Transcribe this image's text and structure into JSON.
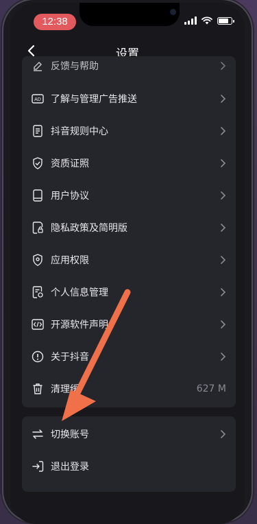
{
  "status_bar": {
    "time": "12:38"
  },
  "nav": {
    "title": "设置"
  },
  "settings_items": [
    {
      "label": "反馈与帮助",
      "icon": "edit-icon"
    },
    {
      "label": "了解与管理广告推送",
      "icon": "ad-icon"
    },
    {
      "label": "抖音规则中心",
      "icon": "rules-icon"
    },
    {
      "label": "资质证照",
      "icon": "shield-check-icon"
    },
    {
      "label": "用户协议",
      "icon": "book-icon"
    },
    {
      "label": "隐私政策及简明版",
      "icon": "privacy-doc-icon"
    },
    {
      "label": "应用权限",
      "icon": "location-shield-icon"
    },
    {
      "label": "个人信息管理",
      "icon": "personal-info-icon"
    },
    {
      "label": "开源软件声明",
      "icon": "code-icon"
    },
    {
      "label": "关于抖音",
      "icon": "info-icon"
    },
    {
      "label": "清理缓",
      "icon": "trash-icon",
      "value": "627 M"
    }
  ],
  "account_items": [
    {
      "label": "切换账号",
      "icon": "switch-icon"
    },
    {
      "label": "退出登录",
      "icon": "logout-icon"
    }
  ],
  "colors": {
    "arrow": "#f0704a",
    "card": "#25252c",
    "background": "#17171c"
  }
}
